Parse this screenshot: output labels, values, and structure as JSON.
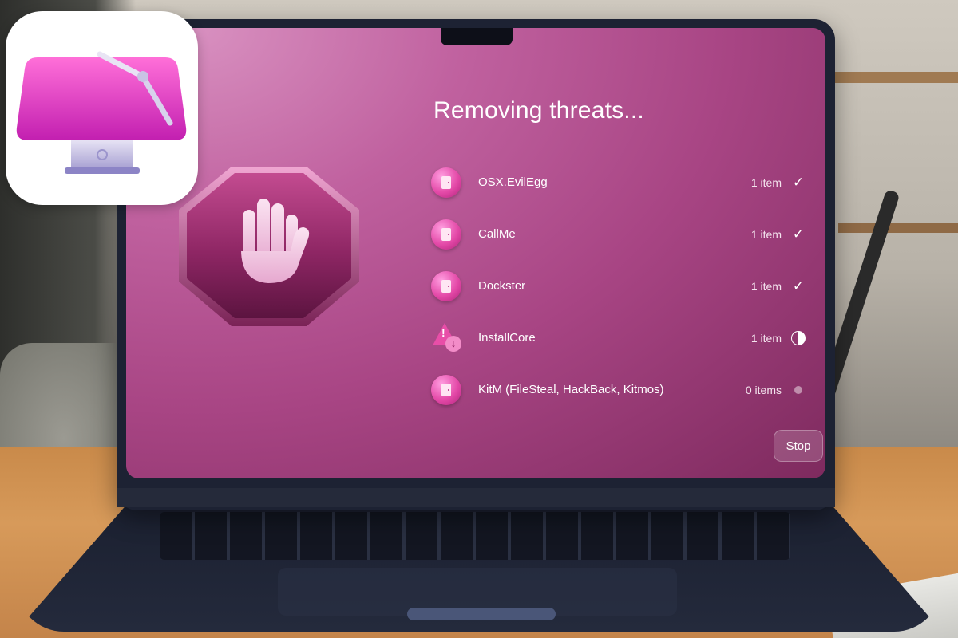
{
  "app": {
    "title": "Removing threats...",
    "stop_label": "Stop"
  },
  "threats": [
    {
      "name": "OSX.EvilEgg",
      "count": "1 item",
      "status": "done",
      "icon": "door-icon"
    },
    {
      "name": "CallMe",
      "count": "1 item",
      "status": "done",
      "icon": "door-icon"
    },
    {
      "name": "Dockster",
      "count": "1 item",
      "status": "done",
      "icon": "door-icon"
    },
    {
      "name": "InstallCore",
      "count": "1 item",
      "status": "in-progress",
      "icon": "warning-download-icon"
    },
    {
      "name": "KitM (FileSteal, HackBack, Kitmos)",
      "count": "0 items",
      "status": "pending",
      "icon": "door-icon"
    }
  ],
  "colors": {
    "accent": "#e44aa8",
    "screen_bg": "#a84584"
  },
  "icons": {
    "hero": "stop-hand-icon",
    "app": "cleanmymac-app-icon"
  }
}
